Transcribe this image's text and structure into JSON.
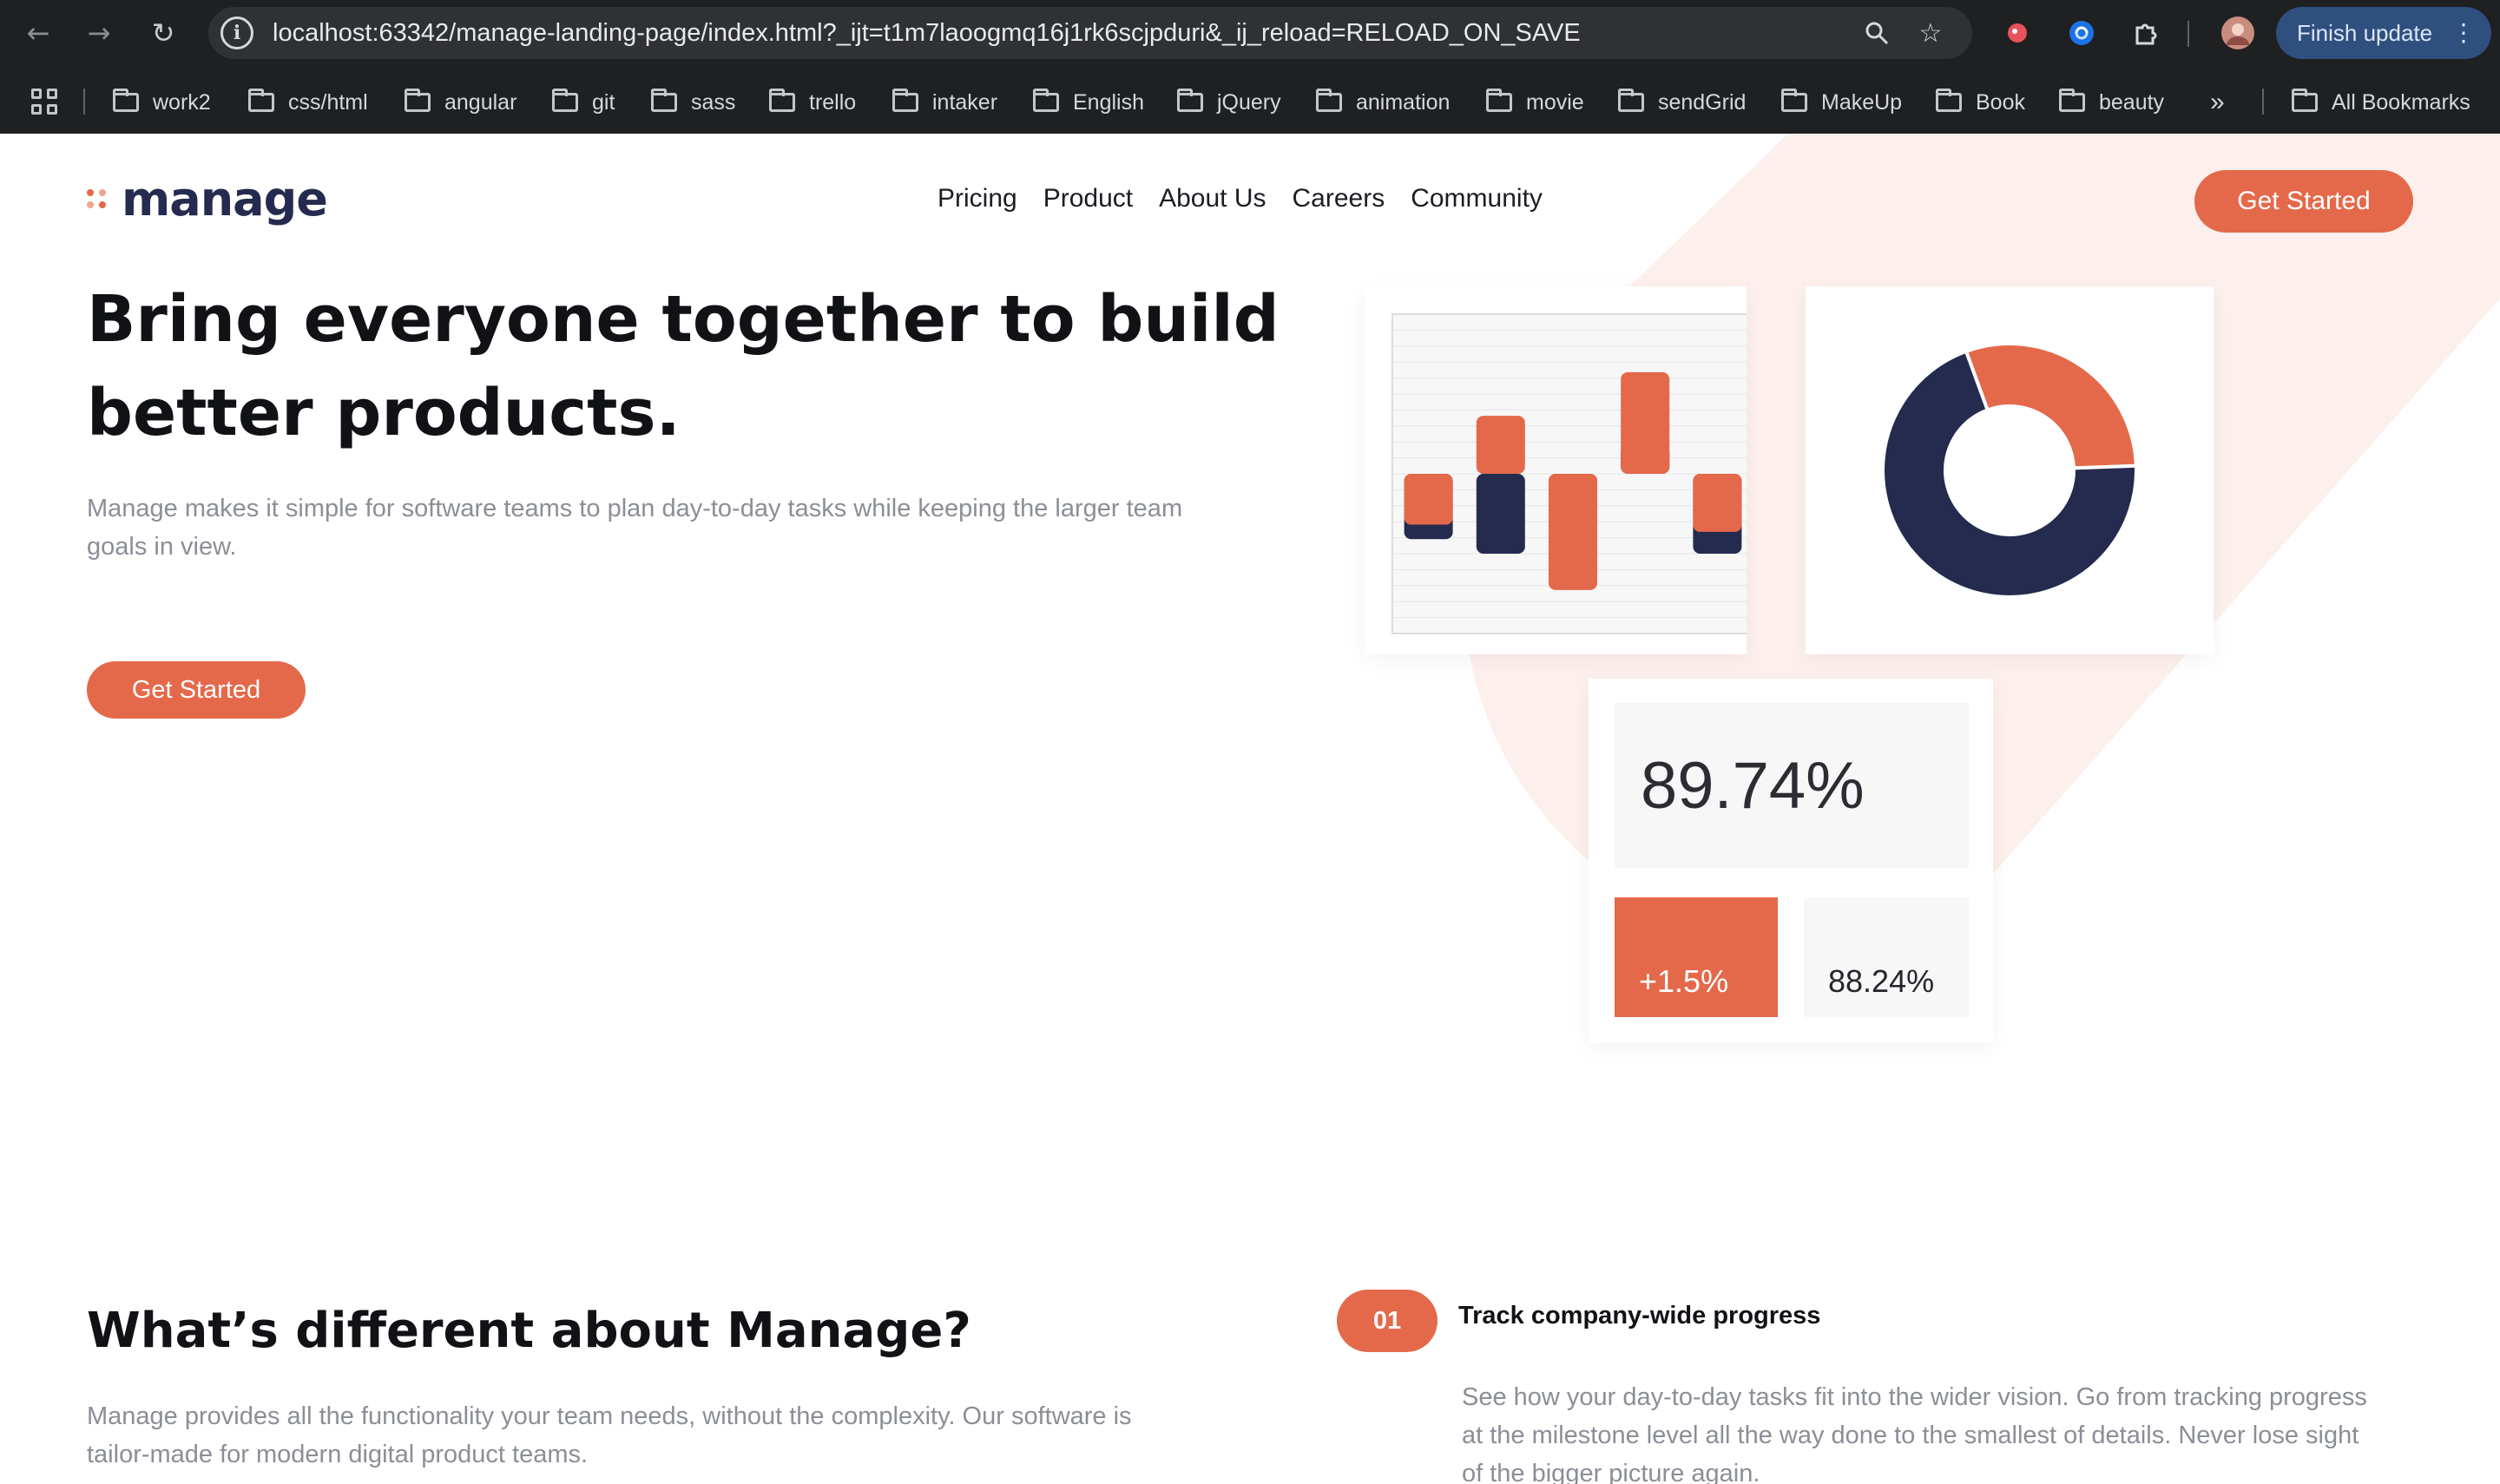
{
  "browser": {
    "url": "localhost:63342/manage-landing-page/index.html?_ijt=t1m7laoogmq16j1rk6scjpduri&_ij_reload=RELOAD_ON_SAVE",
    "update_label": "Finish update",
    "bookmarks": [
      "work2",
      "css/html",
      "angular",
      "git",
      "sass",
      "trello",
      "intaker",
      "English",
      "jQuery",
      "animation",
      "movie",
      "sendGrid",
      "MakeUp",
      "Book",
      "beauty"
    ],
    "all_bookmarks": "All Bookmarks",
    "overflow": "»"
  },
  "site": {
    "logo": "manage",
    "nav": [
      "Pricing",
      "Product",
      "About Us",
      "Careers",
      "Community"
    ],
    "nav_cta": "Get Started"
  },
  "hero": {
    "title": "Bring everyone together to build better products.",
    "text": "Manage makes it simple for software teams to plan day-to-day tasks while keeping the larger team goals in view.",
    "cta": "Get Started"
  },
  "illustration": {
    "stat_main": "89.74%",
    "stat_change": "+1.5%",
    "stat_secondary": "88.24%",
    "colors": {
      "accent": "#e4694a",
      "navy": "#252b4f",
      "peach": "#fdf0ec"
    }
  },
  "chart_data": [
    {
      "type": "bar",
      "categories": [
        "",
        "",
        "",
        "",
        ""
      ],
      "series": [
        {
          "values": [
            -0.35,
            0.4,
            -0.8,
            0.7,
            -0.4
          ]
        },
        {
          "values": [
            -0.45,
            -0.55,
            -0.35,
            0.2,
            -0.55
          ]
        }
      ]
    },
    {
      "type": "pie",
      "slices": [
        30,
        70
      ]
    }
  ],
  "features": {
    "title": "What’s different about Manage?",
    "text": "Manage provides all the functionality your team needs, without the complexity. Our software is tailor-made for modern digital product teams.",
    "items": [
      {
        "number": "01",
        "title": "Track company-wide progress",
        "text": "See how your day-to-day tasks fit into the wider vision. Go from tracking progress at the milestone level all the way done to the smallest of details. Never lose sight of the bigger picture again."
      }
    ]
  }
}
